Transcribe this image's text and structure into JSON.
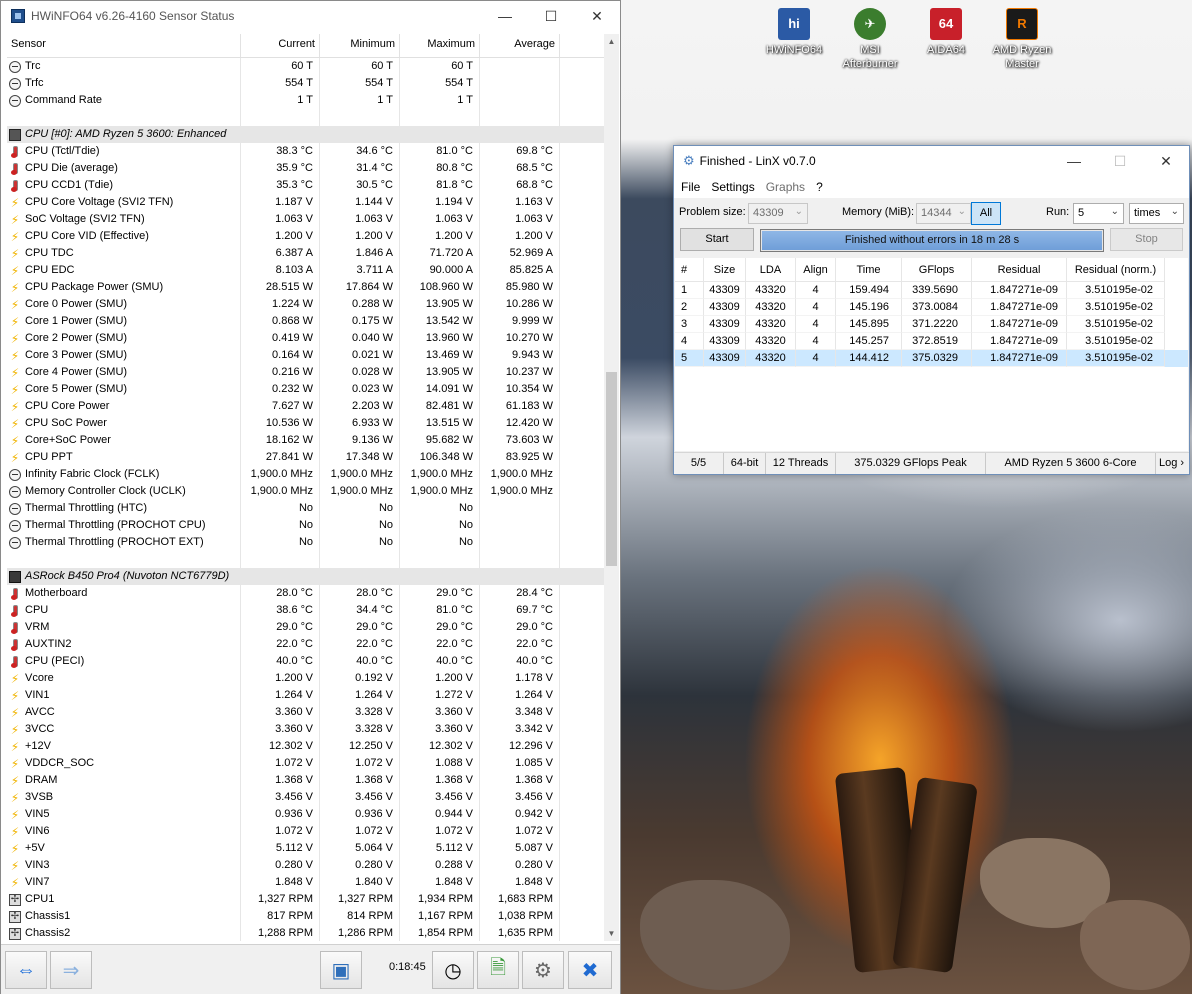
{
  "desktop": {
    "icons": [
      {
        "label": "HWiNFO64",
        "color": "#2b5aa5",
        "glyph": "hi"
      },
      {
        "label": "MSI Afterburner",
        "color": "#3b7d2e",
        "glyph": "✈"
      },
      {
        "label": "AIDA64",
        "color": "#c8202a",
        "glyph": "64"
      },
      {
        "label": "AMD Ryzen Master",
        "color": "#1a1a1a",
        "glyph": "R"
      }
    ]
  },
  "hwinfo": {
    "title": "HWiNFO64 v6.26-4160 Sensor Status",
    "columns": [
      "Sensor",
      "Current",
      "Minimum",
      "Maximum",
      "Average"
    ],
    "rows": [
      {
        "icon": "circle",
        "name": "Trc",
        "cur": "60 T",
        "min": "60 T",
        "max": "60 T",
        "avg": ""
      },
      {
        "icon": "circle",
        "name": "Trfc",
        "cur": "554 T",
        "min": "554 T",
        "max": "554 T",
        "avg": ""
      },
      {
        "icon": "circle",
        "name": "Command Rate",
        "cur": "1 T",
        "min": "1 T",
        "max": "1 T",
        "avg": ""
      },
      {
        "icon": "",
        "name": "",
        "cur": "",
        "min": "",
        "max": "",
        "avg": "",
        "type": "blank"
      },
      {
        "icon": "chip",
        "name": "CPU [#0]: AMD Ryzen 5 3600: Enhanced",
        "cur": "",
        "min": "",
        "max": "",
        "avg": "",
        "type": "group"
      },
      {
        "icon": "therm",
        "name": "CPU (Tctl/Tdie)",
        "cur": "38.3 °C",
        "min": "34.6 °C",
        "max": "81.0 °C",
        "avg": "69.8 °C"
      },
      {
        "icon": "therm",
        "name": "CPU Die (average)",
        "cur": "35.9 °C",
        "min": "31.4 °C",
        "max": "80.8 °C",
        "avg": "68.5 °C"
      },
      {
        "icon": "therm",
        "name": "CPU CCD1 (Tdie)",
        "cur": "35.3 °C",
        "min": "30.5 °C",
        "max": "81.8 °C",
        "avg": "68.8 °C"
      },
      {
        "icon": "bolt",
        "name": "CPU Core Voltage (SVI2 TFN)",
        "cur": "1.187 V",
        "min": "1.144 V",
        "max": "1.194 V",
        "avg": "1.163 V"
      },
      {
        "icon": "bolt",
        "name": "SoC Voltage (SVI2 TFN)",
        "cur": "1.063 V",
        "min": "1.063 V",
        "max": "1.063 V",
        "avg": "1.063 V"
      },
      {
        "icon": "bolt",
        "name": "CPU Core VID (Effective)",
        "cur": "1.200 V",
        "min": "1.200 V",
        "max": "1.200 V",
        "avg": "1.200 V"
      },
      {
        "icon": "bolt",
        "name": "CPU TDC",
        "cur": "6.387 A",
        "min": "1.846 A",
        "max": "71.720 A",
        "avg": "52.969 A"
      },
      {
        "icon": "bolt",
        "name": "CPU EDC",
        "cur": "8.103 A",
        "min": "3.711 A",
        "max": "90.000 A",
        "avg": "85.825 A"
      },
      {
        "icon": "bolt",
        "name": "CPU Package Power (SMU)",
        "cur": "28.515 W",
        "min": "17.864 W",
        "max": "108.960 W",
        "avg": "85.980 W"
      },
      {
        "icon": "bolt",
        "name": "Core 0 Power (SMU)",
        "cur": "1.224 W",
        "min": "0.288 W",
        "max": "13.905 W",
        "avg": "10.286 W"
      },
      {
        "icon": "bolt",
        "name": "Core 1 Power (SMU)",
        "cur": "0.868 W",
        "min": "0.175 W",
        "max": "13.542 W",
        "avg": "9.999 W"
      },
      {
        "icon": "bolt",
        "name": "Core 2 Power (SMU)",
        "cur": "0.419 W",
        "min": "0.040 W",
        "max": "13.960 W",
        "avg": "10.270 W"
      },
      {
        "icon": "bolt",
        "name": "Core 3 Power (SMU)",
        "cur": "0.164 W",
        "min": "0.021 W",
        "max": "13.469 W",
        "avg": "9.943 W"
      },
      {
        "icon": "bolt",
        "name": "Core 4 Power (SMU)",
        "cur": "0.216 W",
        "min": "0.028 W",
        "max": "13.905 W",
        "avg": "10.237 W"
      },
      {
        "icon": "bolt",
        "name": "Core 5 Power (SMU)",
        "cur": "0.232 W",
        "min": "0.023 W",
        "max": "14.091 W",
        "avg": "10.354 W"
      },
      {
        "icon": "bolt",
        "name": "CPU Core Power",
        "cur": "7.627 W",
        "min": "2.203 W",
        "max": "82.481 W",
        "avg": "61.183 W"
      },
      {
        "icon": "bolt",
        "name": "CPU SoC Power",
        "cur": "10.536 W",
        "min": "6.933 W",
        "max": "13.515 W",
        "avg": "12.420 W"
      },
      {
        "icon": "bolt",
        "name": "Core+SoC Power",
        "cur": "18.162 W",
        "min": "9.136 W",
        "max": "95.682 W",
        "avg": "73.603 W"
      },
      {
        "icon": "bolt",
        "name": "CPU PPT",
        "cur": "27.841 W",
        "min": "17.348 W",
        "max": "106.348 W",
        "avg": "83.925 W"
      },
      {
        "icon": "circle",
        "name": "Infinity Fabric Clock (FCLK)",
        "cur": "1,900.0 MHz",
        "min": "1,900.0 MHz",
        "max": "1,900.0 MHz",
        "avg": "1,900.0 MHz"
      },
      {
        "icon": "circle",
        "name": "Memory Controller Clock (UCLK)",
        "cur": "1,900.0 MHz",
        "min": "1,900.0 MHz",
        "max": "1,900.0 MHz",
        "avg": "1,900.0 MHz"
      },
      {
        "icon": "circle",
        "name": "Thermal Throttling (HTC)",
        "cur": "No",
        "min": "No",
        "max": "No",
        "avg": ""
      },
      {
        "icon": "circle",
        "name": "Thermal Throttling (PROCHOT CPU)",
        "cur": "No",
        "min": "No",
        "max": "No",
        "avg": ""
      },
      {
        "icon": "circle",
        "name": "Thermal Throttling (PROCHOT EXT)",
        "cur": "No",
        "min": "No",
        "max": "No",
        "avg": ""
      },
      {
        "icon": "",
        "name": "",
        "cur": "",
        "min": "",
        "max": "",
        "avg": "",
        "type": "blank"
      },
      {
        "icon": "mb",
        "name": "ASRock B450 Pro4 (Nuvoton NCT6779D)",
        "cur": "",
        "min": "",
        "max": "",
        "avg": "",
        "type": "group"
      },
      {
        "icon": "therm",
        "name": "Motherboard",
        "cur": "28.0 °C",
        "min": "28.0 °C",
        "max": "29.0 °C",
        "avg": "28.4 °C"
      },
      {
        "icon": "therm",
        "name": "CPU",
        "cur": "38.6 °C",
        "min": "34.4 °C",
        "max": "81.0 °C",
        "avg": "69.7 °C"
      },
      {
        "icon": "therm",
        "name": "VRM",
        "cur": "29.0 °C",
        "min": "29.0 °C",
        "max": "29.0 °C",
        "avg": "29.0 °C"
      },
      {
        "icon": "therm",
        "name": "AUXTIN2",
        "cur": "22.0 °C",
        "min": "22.0 °C",
        "max": "22.0 °C",
        "avg": "22.0 °C"
      },
      {
        "icon": "therm",
        "name": "CPU (PECI)",
        "cur": "40.0 °C",
        "min": "40.0 °C",
        "max": "40.0 °C",
        "avg": "40.0 °C"
      },
      {
        "icon": "bolt",
        "name": "Vcore",
        "cur": "1.200 V",
        "min": "0.192 V",
        "max": "1.200 V",
        "avg": "1.178 V"
      },
      {
        "icon": "bolt",
        "name": "VIN1",
        "cur": "1.264 V",
        "min": "1.264 V",
        "max": "1.272 V",
        "avg": "1.264 V"
      },
      {
        "icon": "bolt",
        "name": "AVCC",
        "cur": "3.360 V",
        "min": "3.328 V",
        "max": "3.360 V",
        "avg": "3.348 V"
      },
      {
        "icon": "bolt",
        "name": "3VCC",
        "cur": "3.360 V",
        "min": "3.328 V",
        "max": "3.360 V",
        "avg": "3.342 V"
      },
      {
        "icon": "bolt",
        "name": "+12V",
        "cur": "12.302 V",
        "min": "12.250 V",
        "max": "12.302 V",
        "avg": "12.296 V"
      },
      {
        "icon": "bolt",
        "name": "VDDCR_SOC",
        "cur": "1.072 V",
        "min": "1.072 V",
        "max": "1.088 V",
        "avg": "1.085 V"
      },
      {
        "icon": "bolt",
        "name": "DRAM",
        "cur": "1.368 V",
        "min": "1.368 V",
        "max": "1.368 V",
        "avg": "1.368 V"
      },
      {
        "icon": "bolt",
        "name": "3VSB",
        "cur": "3.456 V",
        "min": "3.456 V",
        "max": "3.456 V",
        "avg": "3.456 V"
      },
      {
        "icon": "bolt",
        "name": "VIN5",
        "cur": "0.936 V",
        "min": "0.936 V",
        "max": "0.944 V",
        "avg": "0.942 V"
      },
      {
        "icon": "bolt",
        "name": "VIN6",
        "cur": "1.072 V",
        "min": "1.072 V",
        "max": "1.072 V",
        "avg": "1.072 V"
      },
      {
        "icon": "bolt",
        "name": "+5V",
        "cur": "5.112 V",
        "min": "5.064 V",
        "max": "5.112 V",
        "avg": "5.087 V"
      },
      {
        "icon": "bolt",
        "name": "VIN3",
        "cur": "0.280 V",
        "min": "0.280 V",
        "max": "0.288 V",
        "avg": "0.280 V"
      },
      {
        "icon": "bolt",
        "name": "VIN7",
        "cur": "1.848 V",
        "min": "1.840 V",
        "max": "1.848 V",
        "avg": "1.848 V"
      },
      {
        "icon": "fan",
        "name": "CPU1",
        "cur": "1,327 RPM",
        "min": "1,327 RPM",
        "max": "1,934 RPM",
        "avg": "1,683 RPM"
      },
      {
        "icon": "fan",
        "name": "Chassis1",
        "cur": "817 RPM",
        "min": "814 RPM",
        "max": "1,167 RPM",
        "avg": "1,038 RPM"
      },
      {
        "icon": "fan",
        "name": "Chassis2",
        "cur": "1,288 RPM",
        "min": "1,286 RPM",
        "max": "1,854 RPM",
        "avg": "1,635 RPM"
      }
    ],
    "timer": "0:18:45"
  },
  "linx": {
    "title": "Finished - LinX v0.7.0",
    "menu": [
      {
        "label": "File",
        "enabled": true
      },
      {
        "label": "Settings",
        "enabled": true
      },
      {
        "label": "Graphs",
        "enabled": false
      },
      {
        "label": "?",
        "enabled": true
      }
    ],
    "problem_size_label": "Problem size:",
    "problem_size_value": "43309",
    "memory_label": "Memory (MiB):",
    "memory_value": "14344",
    "all_label": "All",
    "run_label": "Run:",
    "run_value": "5",
    "run_unit": "times",
    "start_label": "Start",
    "stop_label": "Stop",
    "progress_text": "Finished without errors in 18 m 28 s",
    "progress_fraction": 1.0,
    "columns": [
      "#",
      "Size",
      "LDA",
      "Align",
      "Time",
      "GFlops",
      "Residual",
      "Residual (norm.)"
    ],
    "results": [
      [
        "1",
        "43309",
        "43320",
        "4",
        "159.494",
        "339.5690",
        "1.847271e-09",
        "3.510195e-02"
      ],
      [
        "2",
        "43309",
        "43320",
        "4",
        "145.196",
        "373.0084",
        "1.847271e-09",
        "3.510195e-02"
      ],
      [
        "3",
        "43309",
        "43320",
        "4",
        "145.895",
        "371.2220",
        "1.847271e-09",
        "3.510195e-02"
      ],
      [
        "4",
        "43309",
        "43320",
        "4",
        "145.257",
        "372.8519",
        "1.847271e-09",
        "3.510195e-02"
      ],
      [
        "5",
        "43309",
        "43320",
        "4",
        "144.412",
        "375.0329",
        "1.847271e-09",
        "3.510195e-02"
      ]
    ],
    "selected_row": 4,
    "status": [
      "5/5",
      "64-bit",
      "12 Threads",
      "375.0329 GFlops Peak",
      "AMD Ryzen 5 3600 6-Core",
      "Log ›"
    ]
  }
}
